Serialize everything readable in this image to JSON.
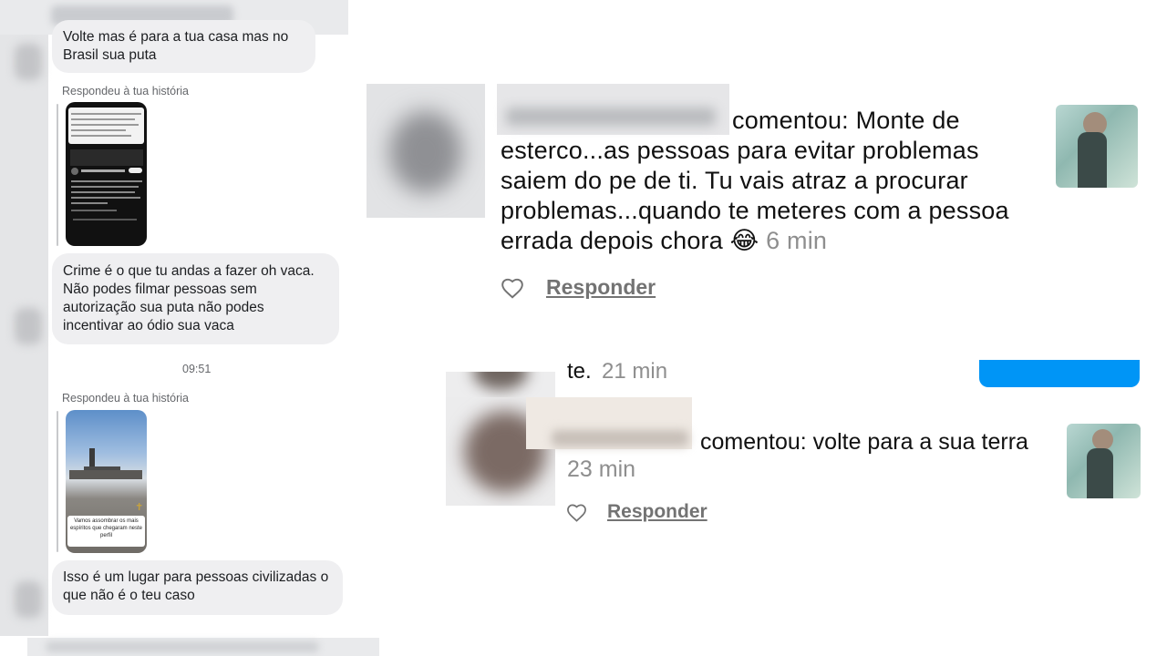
{
  "dm": {
    "messages": [
      {
        "text": "Volte mas é para a tua casa mas no Brasil sua puta"
      },
      {
        "story_label": "Respondeu à tua história"
      },
      {
        "text": "Crime é o que tu andas a fazer oh vaca. Não podes filmar pessoas sem autorização sua puta não podes incentivar ao ódio sua vaca"
      },
      {
        "time": "09:51"
      },
      {
        "story_label": "Respondeu à tua história",
        "story_caption": "Vamos assombrar os mais espíritos que chegaram neste perfil"
      },
      {
        "text": "Isso é um lugar para pessoas civilizadas o que não é o teu caso"
      }
    ]
  },
  "comments": {
    "first": {
      "verb": "comentou: Monte de esterco...as pessoas para evitar problemas saiem do pe de ti. Tu vais atraz a procurar problemas...quando te meteres com a pessoa errada depois chora",
      "emoji": "😂",
      "time": "6 min",
      "reply_label": "Responder"
    },
    "previous": {
      "text_fragment": "te.",
      "time": "21 min"
    },
    "second": {
      "verb": "comentou: volte para a sua terra",
      "time": "23 min",
      "reply_label": "Responder"
    }
  },
  "colors": {
    "bubble": "#efeff1",
    "meta_gray": "#8e8e8e",
    "accent_blue": "#0095f6"
  }
}
